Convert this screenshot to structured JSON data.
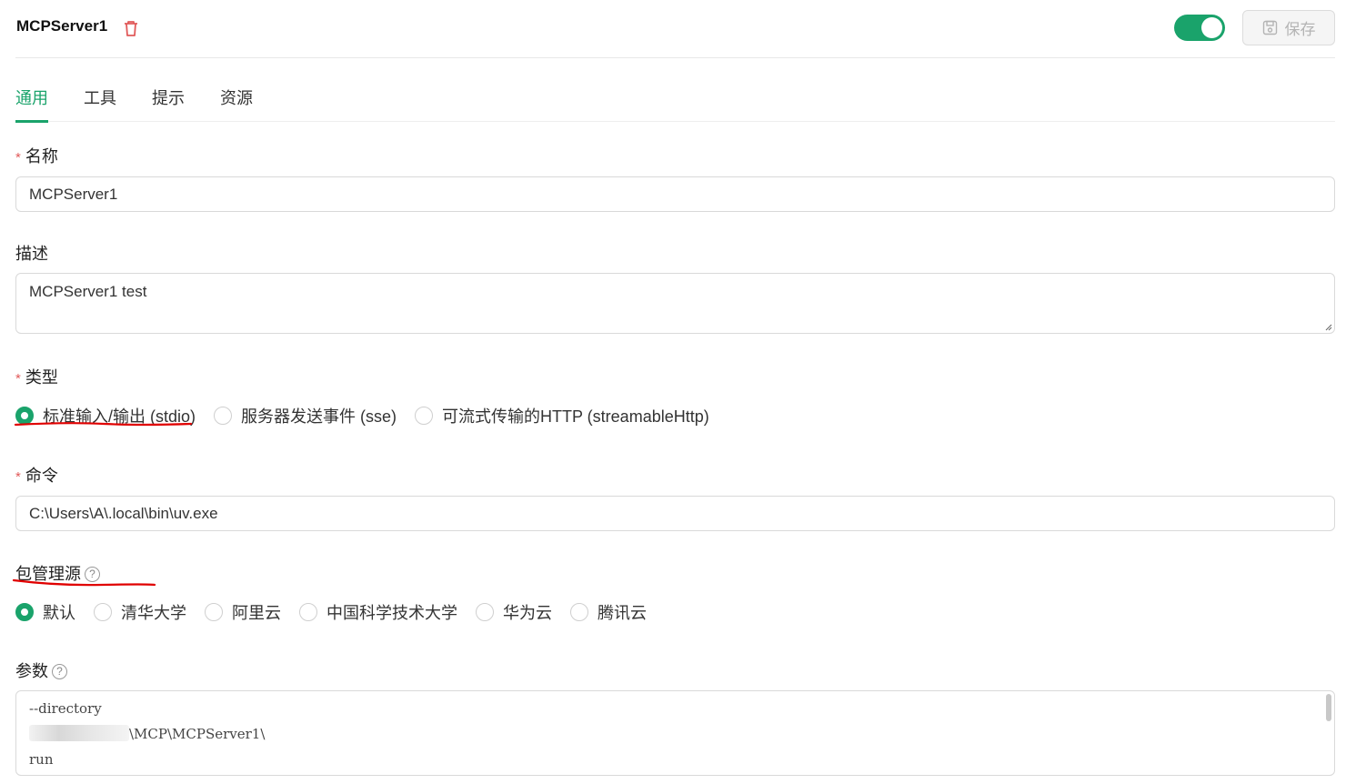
{
  "header": {
    "server_name": "MCPServer1",
    "enabled": true,
    "save_label": "保存"
  },
  "tabs": [
    {
      "label": "通用",
      "active": true
    },
    {
      "label": "工具",
      "active": false
    },
    {
      "label": "提示",
      "active": false
    },
    {
      "label": "资源",
      "active": false
    }
  ],
  "form": {
    "name": {
      "label": "名称",
      "required": true,
      "value": "MCPServer1"
    },
    "description": {
      "label": "描述",
      "required": false,
      "value": "MCPServer1 test"
    },
    "type": {
      "label": "类型",
      "required": true,
      "options": [
        {
          "label": "标准输入/输出 (stdio)",
          "checked": true
        },
        {
          "label": "服务器发送事件 (sse)",
          "checked": false
        },
        {
          "label": "可流式传输的HTTP (streamableHttp)",
          "checked": false
        }
      ]
    },
    "command": {
      "label": "命令",
      "required": true,
      "value": "C:\\Users\\A\\.local\\bin\\uv.exe"
    },
    "package_source": {
      "label": "包管理源",
      "options": [
        {
          "label": "默认",
          "checked": true
        },
        {
          "label": "清华大学",
          "checked": false
        },
        {
          "label": "阿里云",
          "checked": false
        },
        {
          "label": "中国科学技术大学",
          "checked": false
        },
        {
          "label": "华为云",
          "checked": false
        },
        {
          "label": "腾讯云",
          "checked": false
        }
      ]
    },
    "args": {
      "label": "参数",
      "lines": [
        "--directory",
        "\\MCP\\MCPServer1\\",
        "run"
      ]
    }
  },
  "colors": {
    "accent": "#1aa36b",
    "required": "#e15a5a",
    "annotation": "#e00000"
  },
  "icons": [
    "trash-icon",
    "save-icon",
    "help-circle-icon"
  ]
}
